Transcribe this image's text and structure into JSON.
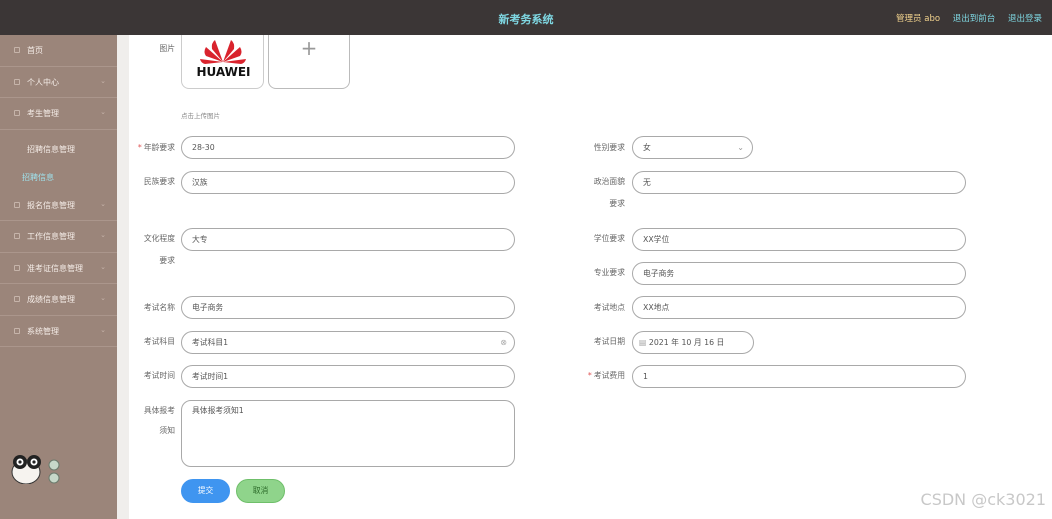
{
  "header": {
    "title": "新考务系统",
    "user": "管理员 abo",
    "back_label": "退出到前台",
    "logout_label": "退出登录"
  },
  "sidebar": {
    "items": [
      {
        "label": "首页"
      },
      {
        "label": "个人中心"
      },
      {
        "label": "考生管理"
      },
      {
        "label": "招聘信息管理"
      },
      {
        "label": "招聘信息"
      },
      {
        "label": "报名信息管理"
      },
      {
        "label": "工作信息管理"
      },
      {
        "label": "准考证信息管理"
      },
      {
        "label": "成绩信息管理"
      },
      {
        "label": "系统管理"
      }
    ]
  },
  "form": {
    "image_label": "图片",
    "image_brand": "HUAWEI",
    "upload_plus": "+",
    "upload_hint": "点击上传图片",
    "age_label": "年龄要求",
    "age_value": "28-30",
    "gender_label": "性别要求",
    "gender_value": "女",
    "ethnic_label": "民族要求",
    "ethnic_value": "汉族",
    "political_label_1": "政治面貌",
    "political_label_2": "要求",
    "political_value": "无",
    "education_label_1": "文化程度",
    "education_label_2": "要求",
    "education_value": "大专",
    "degree_label": "学位要求",
    "degree_value": "XX学位",
    "major_label": "专业要求",
    "major_value": "电子商务",
    "exam_name_label": "考试名称",
    "exam_name_value": "电子商务",
    "exam_place_label": "考试地点",
    "exam_place_value": "XX地点",
    "subject_label": "考试科目",
    "subject_value": "考试科目1",
    "date_label": "考试日期",
    "date_value": "2021 年 10 月 16 日",
    "time_label": "考试时间",
    "time_value": "考试时间1",
    "fee_label": "考试费用",
    "fee_value": "1",
    "notice_label_1": "具体报考",
    "notice_label_2": "须知",
    "notice_value": "具体报考须知1",
    "submit_label": "提交",
    "cancel_label": "取消"
  },
  "watermark": "CSDN @ck3021"
}
